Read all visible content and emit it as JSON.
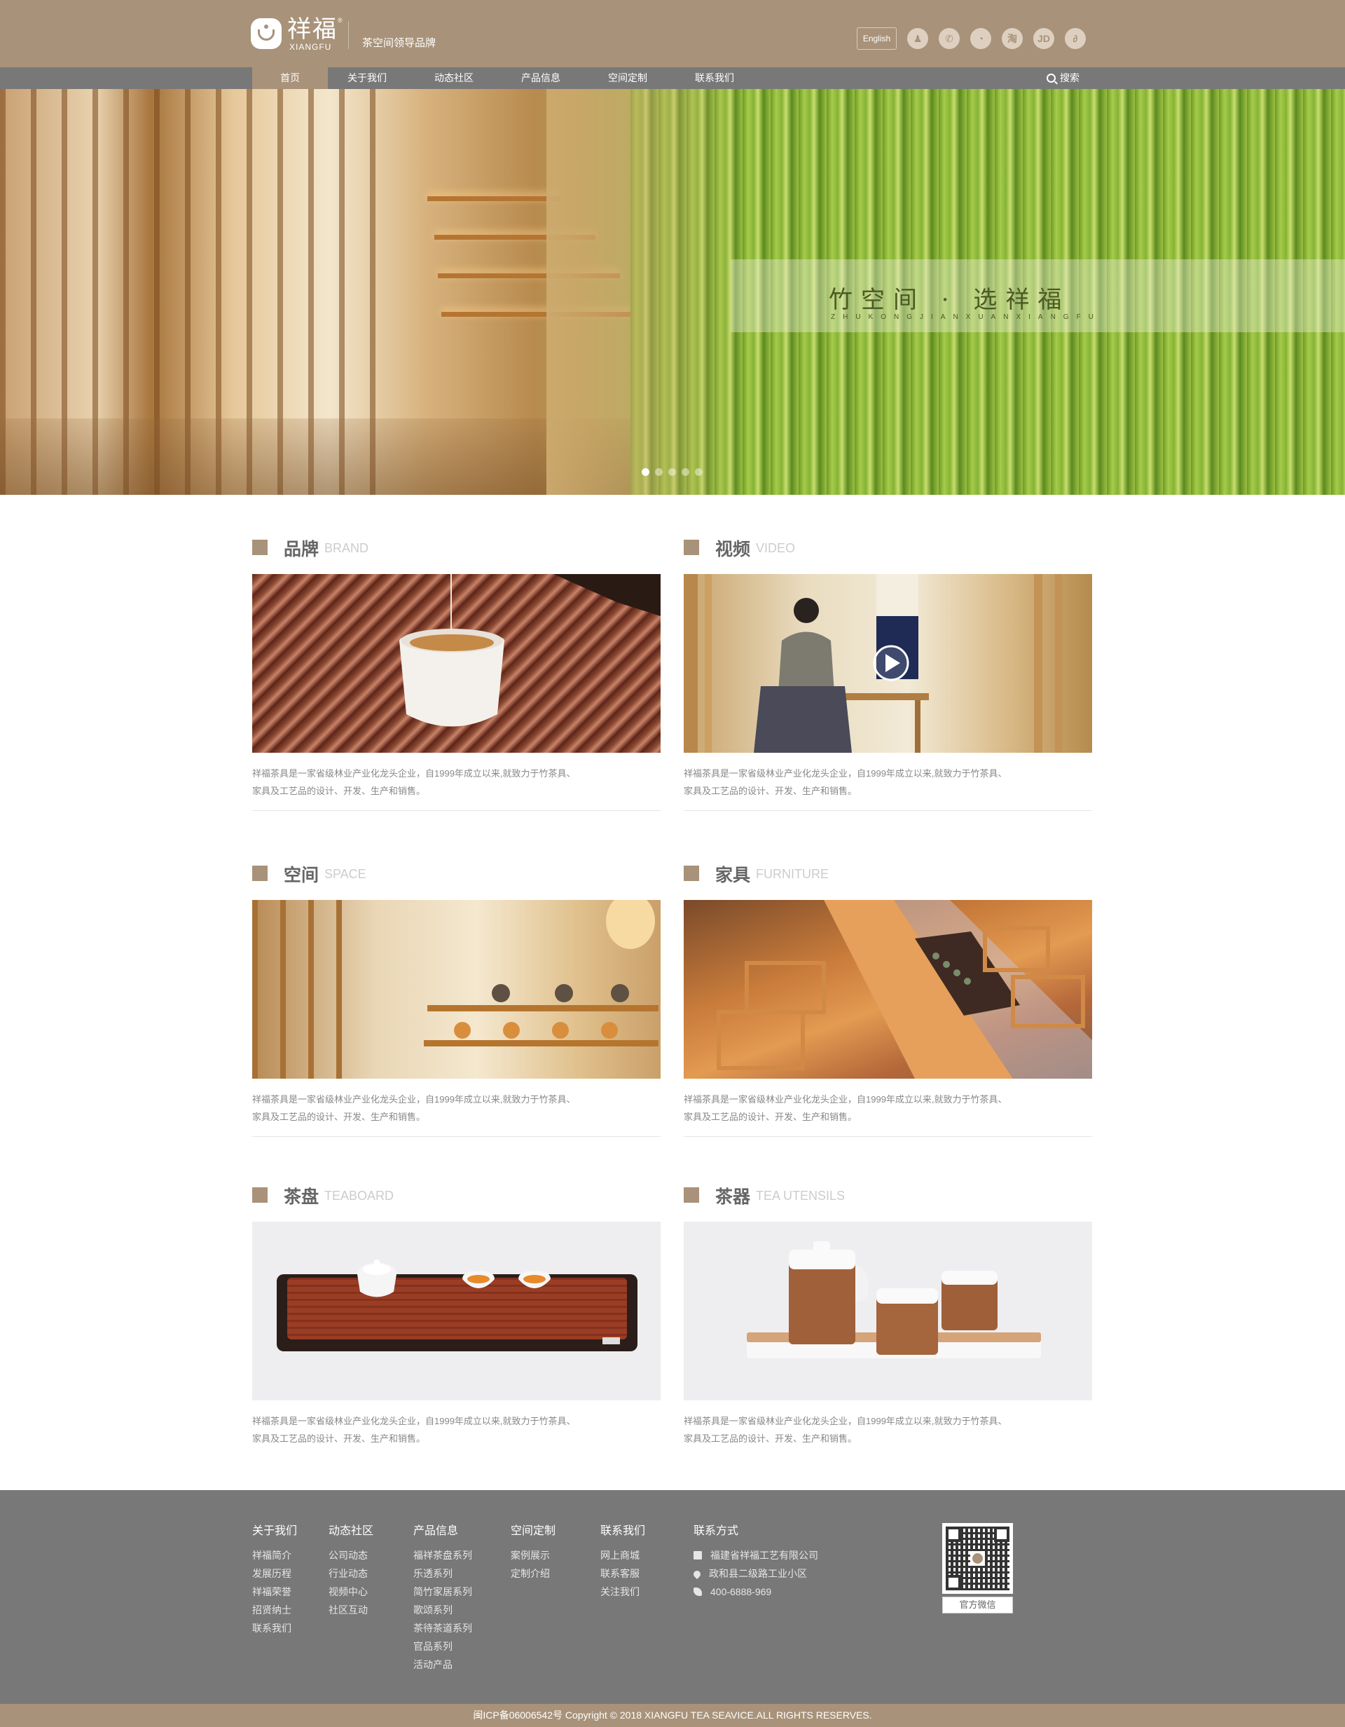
{
  "header": {
    "logo_cn": "祥福",
    "logo_en": "XIANGFU",
    "logo_reg": "®",
    "slogan": "茶空间领导品牌",
    "lang_button": "English",
    "social_icons": [
      {
        "name": "qq-icon",
        "glyph": "♟"
      },
      {
        "name": "wechat-icon",
        "glyph": "✆"
      },
      {
        "name": "weibo-icon",
        "glyph": "◔"
      },
      {
        "name": "taobao-icon",
        "glyph": "淘"
      },
      {
        "name": "jd-icon",
        "glyph": "JD"
      },
      {
        "name": "link-icon",
        "glyph": "∂"
      }
    ]
  },
  "nav": {
    "items": [
      "首页",
      "关于我们",
      "动态社区",
      "产品信息",
      "空间定制",
      "联系我们"
    ],
    "active_index": 0,
    "search_label": "搜索"
  },
  "hero": {
    "title": "竹空间 · 选祥福",
    "subtitle": "ZHUKONGJIANXUANXIANGFU",
    "slides_count": 5,
    "active_slide": 0
  },
  "sections": [
    {
      "key": "brand",
      "title": "品牌",
      "title_en": "BRAND",
      "text_line1": "祥福茶具是一家省级林业产业化龙头企业，自1999年成立以来,就致力于竹茶具、",
      "text_line2": "家具及工艺品的设计、开发、生产和销售。"
    },
    {
      "key": "video",
      "title": "视频",
      "title_en": "VIDEO",
      "text_line1": "祥福茶具是一家省级林业产业化龙头企业，自1999年成立以来,就致力于竹茶具、",
      "text_line2": "家具及工艺品的设计、开发、生产和销售。"
    },
    {
      "key": "space",
      "title": "空间",
      "title_en": "SPACE",
      "text_line1": "祥福茶具是一家省级林业产业化龙头企业，自1999年成立以来,就致力于竹茶具、",
      "text_line2": "家具及工艺品的设计、开发、生产和销售。"
    },
    {
      "key": "furniture",
      "title": "家具",
      "title_en": "FURNITURE",
      "text_line1": "祥福茶具是一家省级林业产业化龙头企业，自1999年成立以来,就致力于竹茶具、",
      "text_line2": "家具及工艺品的设计、开发、生产和销售。"
    },
    {
      "key": "teaboard",
      "title": "茶盘",
      "title_en": "TEABOARD",
      "text_line1": "祥福茶具是一家省级林业产业化龙头企业，自1999年成立以来,就致力于竹茶具、",
      "text_line2": "家具及工艺品的设计、开发、生产和销售。"
    },
    {
      "key": "utensils",
      "title": "茶器",
      "title_en": "TEA UTENSILS",
      "text_line1": "祥福茶具是一家省级林业产业化龙头企业，自1999年成立以来,就致力于竹茶具、",
      "text_line2": "家具及工艺品的设计、开发、生产和销售。"
    }
  ],
  "footer": {
    "columns": [
      {
        "title": "关于我们",
        "links": [
          "祥福简介",
          "发展历程",
          "祥福荣誉",
          "招贤纳士",
          "联系我们"
        ]
      },
      {
        "title": "动态社区",
        "links": [
          "公司动态",
          "行业动态",
          "视频中心",
          "社区互动"
        ]
      },
      {
        "title": "产品信息",
        "links": [
          "福祥茶盘系列",
          "乐透系列",
          "简竹家居系列",
          "歌颂系列",
          "茶待茶道系列",
          "官品系列",
          "活动产品"
        ]
      },
      {
        "title": "空间定制",
        "links": [
          "案例展示",
          "定制介绍"
        ]
      },
      {
        "title": "联系我们",
        "links": [
          "网上商城",
          "联系客服",
          "关注我们"
        ]
      }
    ],
    "contact": {
      "title": "联系方式",
      "company": "福建省祥福工艺有限公司",
      "address": "政和县二级路工业小区",
      "phone": "400-6888-969"
    },
    "qr_button": "官方微信"
  },
  "copyright": "闽ICP备06006542号 Copyright © 2018 XIANGFU TEA SEAVICE.ALL RIGHTS RESERVES.",
  "colors": {
    "brand": "#a89279",
    "nav_bg": "#787878",
    "footer_bg": "#787878"
  }
}
